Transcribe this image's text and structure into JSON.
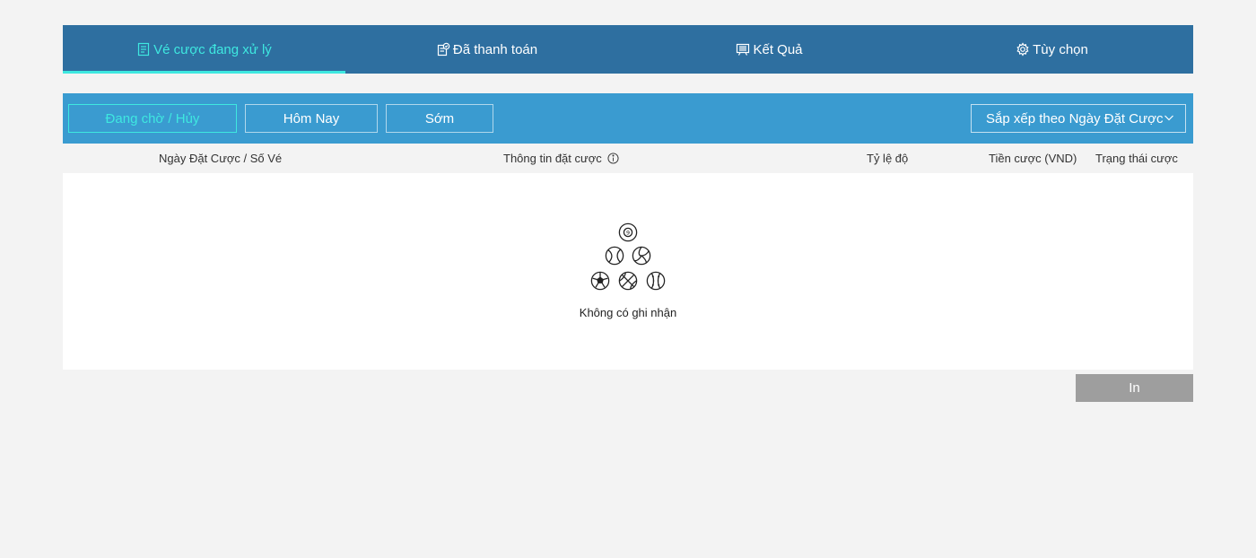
{
  "tabs": [
    {
      "label": "Vé cược đang xử lý",
      "icon": "ticket-list-icon",
      "active": true
    },
    {
      "label": "Đã thanh toán",
      "icon": "paid-icon",
      "active": false
    },
    {
      "label": "Kết Quả",
      "icon": "results-board-icon",
      "active": false
    },
    {
      "label": "Tùy chọn",
      "icon": "gear-icon",
      "active": false
    }
  ],
  "filters": [
    {
      "label": "Đang chờ / Hủy",
      "active": true
    },
    {
      "label": "Hôm Nay",
      "active": false
    },
    {
      "label": "Sớm",
      "active": false
    }
  ],
  "sort": {
    "label": "Sắp xếp theo Ngày Đặt Cược",
    "icon": "chevron-down-icon"
  },
  "columns": {
    "date": "Ngày Đặt Cược / Số Vé",
    "info": "Thông tin đặt cược",
    "odds": "Tỷ lệ độ",
    "stake": "Tiền cược (VND)",
    "status": "Trạng thái cược"
  },
  "empty": {
    "message": "Không có ghi nhận"
  },
  "print": {
    "label": "In"
  },
  "colors": {
    "tab_bar": "#2e6fa0",
    "filter_bar": "#3a9bd0",
    "accent": "#3ee8e0",
    "print_button": "#9e9e9e",
    "page_bg": "#f3f3f3"
  }
}
